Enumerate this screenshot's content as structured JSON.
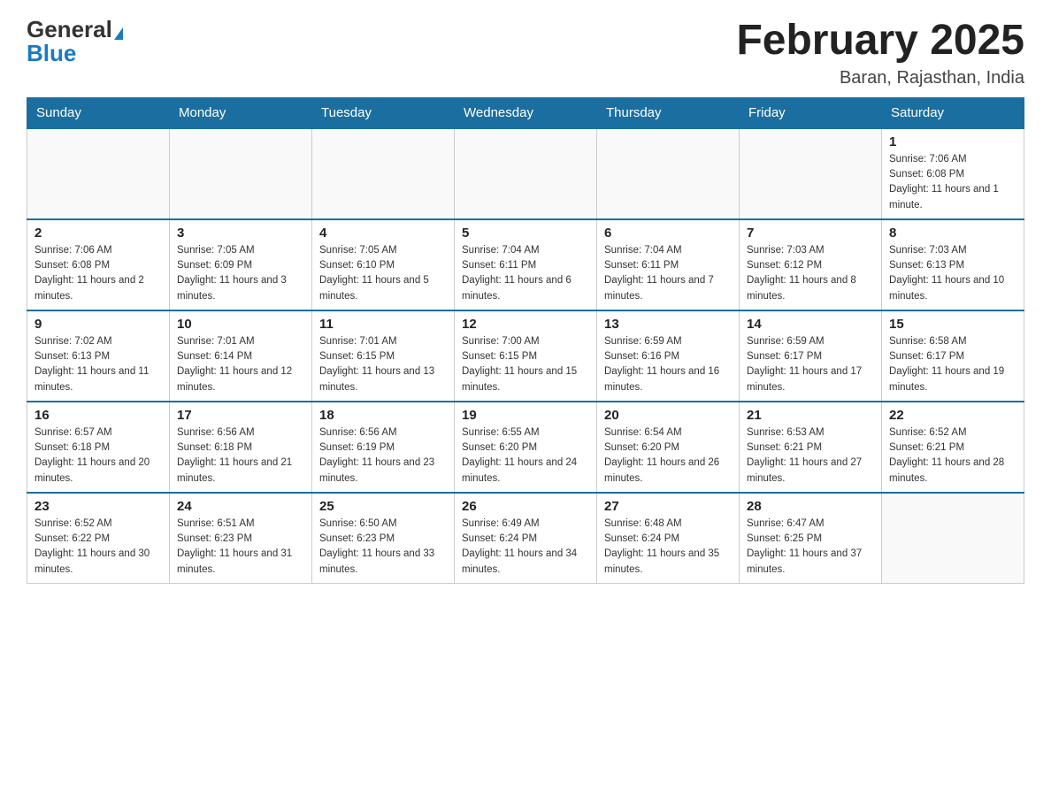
{
  "header": {
    "logo_general": "General",
    "logo_blue": "Blue",
    "title": "February 2025",
    "subtitle": "Baran, Rajasthan, India"
  },
  "weekdays": [
    "Sunday",
    "Monday",
    "Tuesday",
    "Wednesday",
    "Thursday",
    "Friday",
    "Saturday"
  ],
  "weeks": [
    [
      {
        "day": "",
        "sunrise": "",
        "sunset": "",
        "daylight": ""
      },
      {
        "day": "",
        "sunrise": "",
        "sunset": "",
        "daylight": ""
      },
      {
        "day": "",
        "sunrise": "",
        "sunset": "",
        "daylight": ""
      },
      {
        "day": "",
        "sunrise": "",
        "sunset": "",
        "daylight": ""
      },
      {
        "day": "",
        "sunrise": "",
        "sunset": "",
        "daylight": ""
      },
      {
        "day": "",
        "sunrise": "",
        "sunset": "",
        "daylight": ""
      },
      {
        "day": "1",
        "sunrise": "Sunrise: 7:06 AM",
        "sunset": "Sunset: 6:08 PM",
        "daylight": "Daylight: 11 hours and 1 minute."
      }
    ],
    [
      {
        "day": "2",
        "sunrise": "Sunrise: 7:06 AM",
        "sunset": "Sunset: 6:08 PM",
        "daylight": "Daylight: 11 hours and 2 minutes."
      },
      {
        "day": "3",
        "sunrise": "Sunrise: 7:05 AM",
        "sunset": "Sunset: 6:09 PM",
        "daylight": "Daylight: 11 hours and 3 minutes."
      },
      {
        "day": "4",
        "sunrise": "Sunrise: 7:05 AM",
        "sunset": "Sunset: 6:10 PM",
        "daylight": "Daylight: 11 hours and 5 minutes."
      },
      {
        "day": "5",
        "sunrise": "Sunrise: 7:04 AM",
        "sunset": "Sunset: 6:11 PM",
        "daylight": "Daylight: 11 hours and 6 minutes."
      },
      {
        "day": "6",
        "sunrise": "Sunrise: 7:04 AM",
        "sunset": "Sunset: 6:11 PM",
        "daylight": "Daylight: 11 hours and 7 minutes."
      },
      {
        "day": "7",
        "sunrise": "Sunrise: 7:03 AM",
        "sunset": "Sunset: 6:12 PM",
        "daylight": "Daylight: 11 hours and 8 minutes."
      },
      {
        "day": "8",
        "sunrise": "Sunrise: 7:03 AM",
        "sunset": "Sunset: 6:13 PM",
        "daylight": "Daylight: 11 hours and 10 minutes."
      }
    ],
    [
      {
        "day": "9",
        "sunrise": "Sunrise: 7:02 AM",
        "sunset": "Sunset: 6:13 PM",
        "daylight": "Daylight: 11 hours and 11 minutes."
      },
      {
        "day": "10",
        "sunrise": "Sunrise: 7:01 AM",
        "sunset": "Sunset: 6:14 PM",
        "daylight": "Daylight: 11 hours and 12 minutes."
      },
      {
        "day": "11",
        "sunrise": "Sunrise: 7:01 AM",
        "sunset": "Sunset: 6:15 PM",
        "daylight": "Daylight: 11 hours and 13 minutes."
      },
      {
        "day": "12",
        "sunrise": "Sunrise: 7:00 AM",
        "sunset": "Sunset: 6:15 PM",
        "daylight": "Daylight: 11 hours and 15 minutes."
      },
      {
        "day": "13",
        "sunrise": "Sunrise: 6:59 AM",
        "sunset": "Sunset: 6:16 PM",
        "daylight": "Daylight: 11 hours and 16 minutes."
      },
      {
        "day": "14",
        "sunrise": "Sunrise: 6:59 AM",
        "sunset": "Sunset: 6:17 PM",
        "daylight": "Daylight: 11 hours and 17 minutes."
      },
      {
        "day": "15",
        "sunrise": "Sunrise: 6:58 AM",
        "sunset": "Sunset: 6:17 PM",
        "daylight": "Daylight: 11 hours and 19 minutes."
      }
    ],
    [
      {
        "day": "16",
        "sunrise": "Sunrise: 6:57 AM",
        "sunset": "Sunset: 6:18 PM",
        "daylight": "Daylight: 11 hours and 20 minutes."
      },
      {
        "day": "17",
        "sunrise": "Sunrise: 6:56 AM",
        "sunset": "Sunset: 6:18 PM",
        "daylight": "Daylight: 11 hours and 21 minutes."
      },
      {
        "day": "18",
        "sunrise": "Sunrise: 6:56 AM",
        "sunset": "Sunset: 6:19 PM",
        "daylight": "Daylight: 11 hours and 23 minutes."
      },
      {
        "day": "19",
        "sunrise": "Sunrise: 6:55 AM",
        "sunset": "Sunset: 6:20 PM",
        "daylight": "Daylight: 11 hours and 24 minutes."
      },
      {
        "day": "20",
        "sunrise": "Sunrise: 6:54 AM",
        "sunset": "Sunset: 6:20 PM",
        "daylight": "Daylight: 11 hours and 26 minutes."
      },
      {
        "day": "21",
        "sunrise": "Sunrise: 6:53 AM",
        "sunset": "Sunset: 6:21 PM",
        "daylight": "Daylight: 11 hours and 27 minutes."
      },
      {
        "day": "22",
        "sunrise": "Sunrise: 6:52 AM",
        "sunset": "Sunset: 6:21 PM",
        "daylight": "Daylight: 11 hours and 28 minutes."
      }
    ],
    [
      {
        "day": "23",
        "sunrise": "Sunrise: 6:52 AM",
        "sunset": "Sunset: 6:22 PM",
        "daylight": "Daylight: 11 hours and 30 minutes."
      },
      {
        "day": "24",
        "sunrise": "Sunrise: 6:51 AM",
        "sunset": "Sunset: 6:23 PM",
        "daylight": "Daylight: 11 hours and 31 minutes."
      },
      {
        "day": "25",
        "sunrise": "Sunrise: 6:50 AM",
        "sunset": "Sunset: 6:23 PM",
        "daylight": "Daylight: 11 hours and 33 minutes."
      },
      {
        "day": "26",
        "sunrise": "Sunrise: 6:49 AM",
        "sunset": "Sunset: 6:24 PM",
        "daylight": "Daylight: 11 hours and 34 minutes."
      },
      {
        "day": "27",
        "sunrise": "Sunrise: 6:48 AM",
        "sunset": "Sunset: 6:24 PM",
        "daylight": "Daylight: 11 hours and 35 minutes."
      },
      {
        "day": "28",
        "sunrise": "Sunrise: 6:47 AM",
        "sunset": "Sunset: 6:25 PM",
        "daylight": "Daylight: 11 hours and 37 minutes."
      },
      {
        "day": "",
        "sunrise": "",
        "sunset": "",
        "daylight": ""
      }
    ]
  ]
}
